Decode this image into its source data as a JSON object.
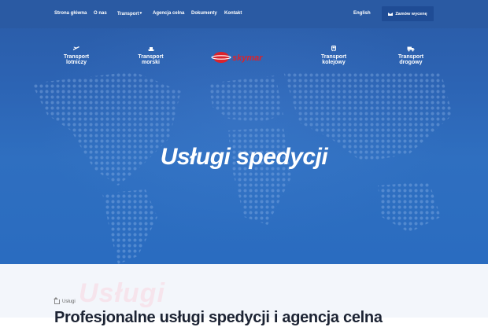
{
  "nav": {
    "home": "Strona główna",
    "about": "O nas",
    "transport": "Transport",
    "customs": "Agencja celna",
    "documents": "Dokumenty",
    "contact": "Kontakt",
    "language": "English",
    "order_button": "Zamów wycenę"
  },
  "services": [
    {
      "label": "Transport lotniczy",
      "icon": "plane-icon"
    },
    {
      "label": "Transport morski",
      "icon": "ship-icon"
    },
    {
      "label": "Transport kolejowy",
      "icon": "train-icon"
    },
    {
      "label": "Transport drogowy",
      "icon": "truck-icon"
    }
  ],
  "logo": {
    "text": "skymar"
  },
  "hero": {
    "title": "Usługi spedycji"
  },
  "content": {
    "breadcrumb": "Usługi",
    "ghost_text": "Usługi",
    "heading": "Profesjonalne usługi spedycji i agencja celna"
  },
  "colors": {
    "primary": "#2a5aa3",
    "button": "#1f4c95",
    "logo_red": "#d9232d"
  }
}
